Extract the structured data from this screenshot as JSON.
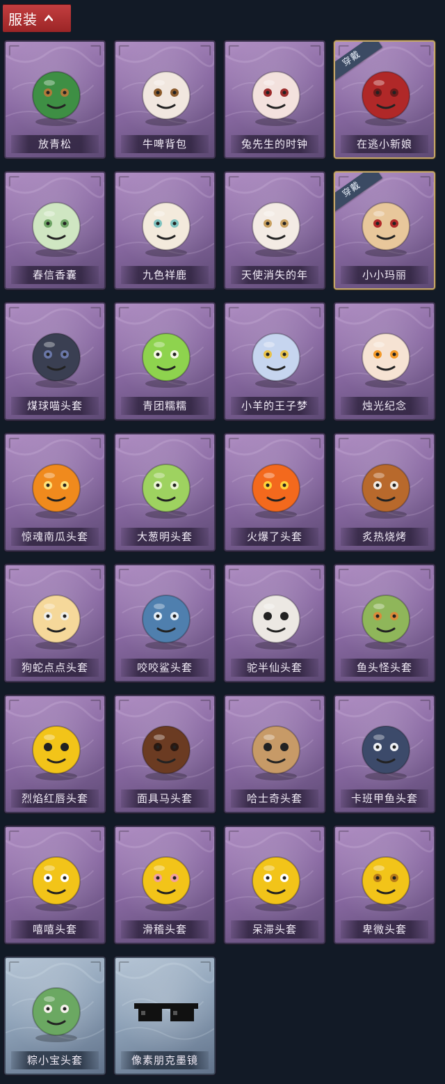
{
  "section": {
    "title": "服装",
    "expanded_icon": "chevron-up-icon"
  },
  "equipped_badge": "穿戴",
  "items": [
    {
      "name": "放青松",
      "icon": "bonsai-pine-icon",
      "theme": "purple",
      "equipped": false
    },
    {
      "name": "牛啤背包",
      "icon": "cow-beer-barrel-icon",
      "theme": "purple",
      "equipped": false
    },
    {
      "name": "兔先生的时钟",
      "icon": "rabbit-clock-icon",
      "theme": "purple",
      "equipped": false
    },
    {
      "name": "在逃小新娘",
      "icon": "bride-doll-icon",
      "theme": "purple",
      "equipped": true
    },
    {
      "name": "春信香囊",
      "icon": "sachet-icon",
      "theme": "purple",
      "equipped": false
    },
    {
      "name": "九色祥鹿",
      "icon": "deer-charm-icon",
      "theme": "purple",
      "equipped": false
    },
    {
      "name": "天使消失的年",
      "icon": "angel-doll-icon",
      "theme": "purple",
      "equipped": false
    },
    {
      "name": "小小玛丽",
      "icon": "mary-doll-icon",
      "theme": "purple",
      "equipped": true
    },
    {
      "name": "煤球喵头套",
      "icon": "black-cat-head-icon",
      "theme": "purple",
      "equipped": false
    },
    {
      "name": "青团糯糯",
      "icon": "green-rice-ball-icon",
      "theme": "purple",
      "equipped": false
    },
    {
      "name": "小羊的王子梦",
      "icon": "sheep-crown-icon",
      "theme": "purple",
      "equipped": false
    },
    {
      "name": "烛光纪念",
      "icon": "candle-icon",
      "theme": "purple",
      "equipped": false
    },
    {
      "name": "惊魂南瓜头套",
      "icon": "pumpkin-head-icon",
      "theme": "purple",
      "equipped": false
    },
    {
      "name": "大葱明头套",
      "icon": "green-onion-head-icon",
      "theme": "purple",
      "equipped": false
    },
    {
      "name": "火爆了头套",
      "icon": "fire-head-icon",
      "theme": "purple",
      "equipped": false
    },
    {
      "name": "炙热烧烤",
      "icon": "bbq-meat-icon",
      "theme": "purple",
      "equipped": false
    },
    {
      "name": "狗蛇点点头套",
      "icon": "snake-head-icon",
      "theme": "purple",
      "equipped": false
    },
    {
      "name": "咬咬鲨头套",
      "icon": "shark-head-icon",
      "theme": "purple",
      "equipped": false
    },
    {
      "name": "驼半仙头套",
      "icon": "bear-sunglasses-icon",
      "theme": "purple",
      "equipped": false
    },
    {
      "name": "鱼头怪头套",
      "icon": "fish-head-icon",
      "theme": "purple",
      "equipped": false
    },
    {
      "name": "烈焰红唇头套",
      "icon": "yellow-mouse-head-icon",
      "theme": "purple",
      "equipped": false
    },
    {
      "name": "面具马头套",
      "icon": "horse-head-icon",
      "theme": "purple",
      "equipped": false
    },
    {
      "name": "哈士奇头套",
      "icon": "husky-head-icon",
      "theme": "purple",
      "equipped": false
    },
    {
      "name": "卡班甲鱼头套",
      "icon": "seal-head-icon",
      "theme": "purple",
      "equipped": false
    },
    {
      "name": "嘻嘻头套",
      "icon": "grin-emoji-head-icon",
      "theme": "purple",
      "equipped": false
    },
    {
      "name": "滑稽头套",
      "icon": "smirk-emoji-head-icon",
      "theme": "purple",
      "equipped": false
    },
    {
      "name": "呆滞头套",
      "icon": "dazed-emoji-head-icon",
      "theme": "purple",
      "equipped": false
    },
    {
      "name": "卑微头套",
      "icon": "humble-emoji-head-icon",
      "theme": "purple",
      "equipped": false
    },
    {
      "name": "粽小宝头套",
      "icon": "zongzi-head-icon",
      "theme": "blue",
      "equipped": false
    },
    {
      "name": "像素朋克墨镜",
      "icon": "pixel-sunglasses-icon",
      "theme": "blue",
      "equipped": false
    }
  ],
  "colors": {
    "background": "#121a26",
    "header": "#b8302f",
    "card_purple": "#8a6aa3",
    "card_blue": "#8ea2b8",
    "equipped_border": "#c4a76a",
    "emoji_yellow": "#f2c419"
  }
}
